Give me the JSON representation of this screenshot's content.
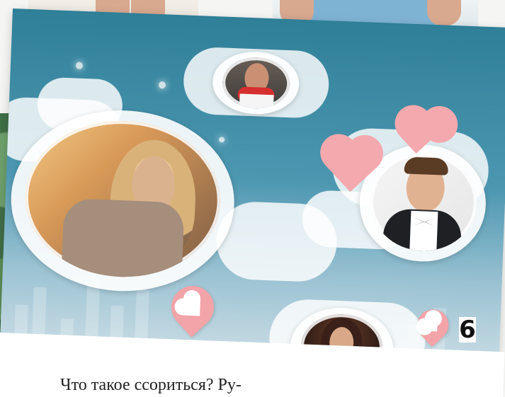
{
  "page": {
    "page_number": "6",
    "body_text": "Что такое ссориться? Ру-"
  },
  "colors": {
    "sky_top": "#2f7f98",
    "sky_mid": "#4d97b1",
    "sky_bottom": "#d6e3e9",
    "pin_pink": "#f2a4a8",
    "text_black": "#111111"
  }
}
